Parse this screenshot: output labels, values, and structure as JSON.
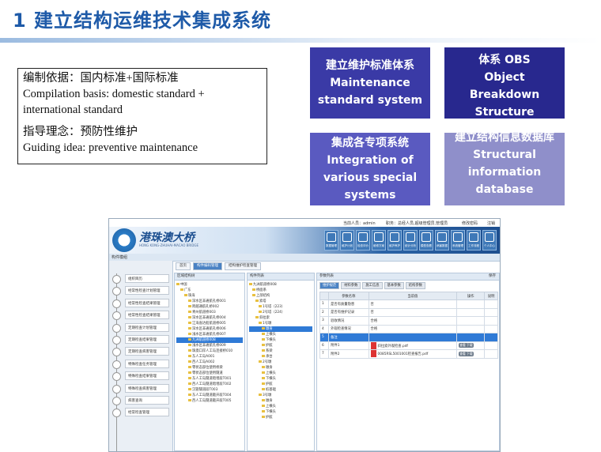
{
  "slide": {
    "title": "1  建立结构运维技术集成系统"
  },
  "basis": {
    "line1": "编制依据：国内标准+国际标准",
    "line2": " Compilation basis: domestic standard + international standard",
    "line3": "指导理念：预防性维护",
    "line4": "Guiding idea: preventive maintenance"
  },
  "tiles": {
    "t1_zh": "建立维护标准体系",
    "t1_en": "Maintenance standard system",
    "t2_zh": "建立工程单元分解结构体系 OBS",
    "t2_en": "Object Breakdown Structure",
    "t3_zh": "集成各专项系统",
    "t3_en": "Integration of various special systems",
    "t4_zh": "建立结构信息数据库",
    "t4_en": "Structural information database"
  },
  "app": {
    "topbar": {
      "user": "当前人员：admin",
      "role": "职务：总经人员,超级管理员,管理员",
      "password": "修改密码",
      "logout": "注销"
    },
    "logo_text": "港珠澳大桥",
    "logo_sub": "HONG KONG-ZHUHAI-MACAO BRIDGE",
    "tools": [
      "数据管理",
      "维护计划",
      "检查评价",
      "维修方案",
      "维护养护",
      "统计分析",
      "模型查看",
      "病害数据",
      "系统管理",
      "工作流程",
      "个人中心"
    ],
    "nav": {
      "side_title": "构件模组",
      "home": "首页",
      "tab1": "构件编码管理",
      "tab2": "结构维护检查管理"
    },
    "sidebar_items": [
      "组织目历",
      "经常性检查计划管理",
      "经常性检查结果管理",
      "经常性检查结果管理",
      "定期检查计划管理",
      "定期检查结果管理",
      "定期检查病害管理",
      "特殊检查任务管理",
      "特殊检查结果管理",
      "特殊检查病害管理",
      "病害查询",
      "经常检查管理"
    ],
    "panel1": {
      "title": "区域结构树",
      "rows": [
        "中国",
        "广东",
        "珠海",
        "深水区非通航孔桥001",
        "跨越通航孔桥002",
        "青州航道桥003",
        "深水区非通航孔桥004",
        "江海直达船航道桥005",
        "深水区非通航孔桥006",
        "浅水区非通航孔桥007",
        "九洲航道桥008",
        "浅水区非通航孔桥009",
        "珠澳口岸人工岛连接桥010",
        "东人工岛A001",
        "西人工岛A002",
        "零状态部位使用桥梁",
        "零状态部位使用隧道",
        "东人工岛隧道暗埋段T001",
        "西人工岛隧道暗埋段T002",
        "沉管隧道段T003",
        "东人工岛隧道敞开段T004",
        "西人工岛隧道敞开段T005"
      ]
    },
    "panel2": {
      "title": "构件列表",
      "rows": [
        "九洲航道桥008",
        "桥面系",
        "上部结构",
        "索塔",
        "1号塔（223）",
        "2号塔（224）",
        "斜拉索",
        "1号墩",
        "墩身",
        "上横头",
        "下横头",
        "护舷",
        "系梁",
        "承台",
        "2号墩",
        "墩身",
        "上横头",
        "下横头",
        "护舷",
        "桩基础",
        "3号墩",
        "墩身",
        "上横头",
        "下横头",
        "护舷"
      ]
    },
    "panel3": {
      "title": "参数列表",
      "save": "保存",
      "subtabs": [
        "维护规范",
        "材料参数",
        "施工信息",
        "基本参数",
        "结构参数"
      ],
      "headers": [
        "",
        "参数名称",
        "当前值",
        "操作",
        "说明"
      ],
      "rows": [
        {
          "no": "1",
          "name": "是否有质量隐患",
          "value": "否",
          "op": ""
        },
        {
          "no": "2",
          "name": "是否有维护记录",
          "value": "否",
          "op": ""
        },
        {
          "no": "3",
          "name": "验收情况",
          "value": "合格",
          "op": ""
        },
        {
          "no": "4",
          "name": "外观检查情况",
          "value": "合格",
          "op": ""
        },
        {
          "no": "5",
          "name": "备注",
          "value": "",
          "op": ""
        },
        {
          "no": "6",
          "name": "附件1",
          "value": "斜拉索外观检查.pdf",
          "op": "查看 下载"
        },
        {
          "no": "7",
          "name": "附件2",
          "value": "0085RSL5001001检查报告.pdf",
          "op": "查看 下载"
        }
      ]
    }
  }
}
